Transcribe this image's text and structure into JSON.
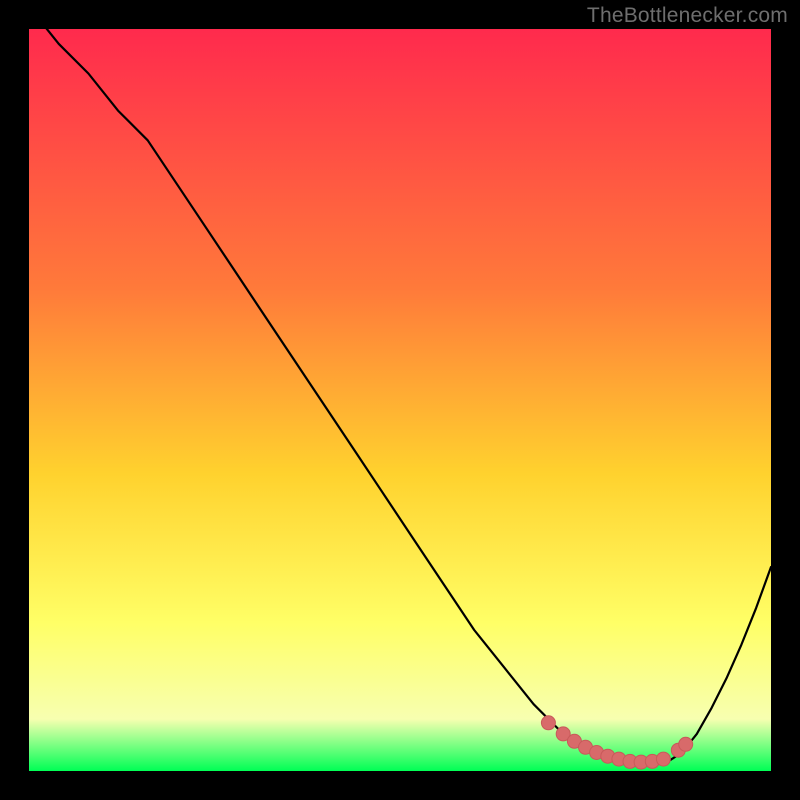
{
  "watermark": "TheBottlenecker.com",
  "colors": {
    "frame": "#000000",
    "curve": "#000000",
    "marker_fill": "#d86a6a",
    "marker_stroke": "#c85a5a",
    "gradient_top": "#ff2a4d",
    "gradient_mid1": "#ff7a3a",
    "gradient_mid2": "#ffd22e",
    "gradient_mid3": "#ffff66",
    "gradient_mid4": "#f7ffb0",
    "gradient_bottom": "#00ff55"
  },
  "chart_data": {
    "type": "line",
    "title": "",
    "xlabel": "",
    "ylabel": "",
    "xlim": [
      0,
      100
    ],
    "ylim": [
      0,
      100
    ],
    "series": [
      {
        "name": "bottleneck-curve",
        "x": [
          0,
          4,
          8,
          12,
          16,
          20,
          24,
          28,
          32,
          36,
          40,
          44,
          48,
          52,
          56,
          60,
          64,
          68,
          72,
          74,
          76,
          78,
          80,
          82,
          84,
          86,
          88,
          90,
          92,
          94,
          96,
          98,
          100
        ],
        "y": [
          103,
          98,
          94,
          89,
          85,
          79,
          73,
          67,
          61,
          55,
          49,
          43,
          37,
          31,
          25,
          19,
          14,
          9,
          5,
          3.5,
          2.3,
          1.5,
          1.0,
          0.8,
          0.8,
          1.2,
          2.5,
          5.0,
          8.5,
          12.5,
          17.0,
          22.0,
          27.5
        ]
      }
    ],
    "markers": {
      "name": "optimal-region",
      "x": [
        70,
        72,
        73.5,
        75,
        76.5,
        78,
        79.5,
        81,
        82.5,
        84,
        85.5,
        87.5,
        88.5
      ],
      "y": [
        6.5,
        5.0,
        4.0,
        3.2,
        2.5,
        2.0,
        1.6,
        1.3,
        1.2,
        1.3,
        1.6,
        2.8,
        3.6
      ]
    }
  }
}
